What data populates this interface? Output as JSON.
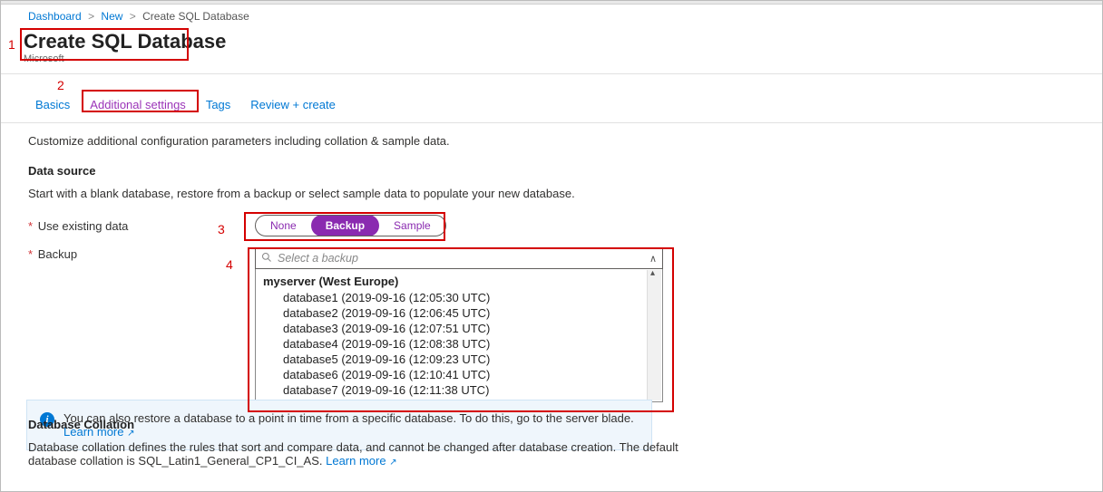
{
  "breadcrumb": {
    "items": [
      "Dashboard",
      "New",
      "Create SQL Database"
    ]
  },
  "header": {
    "title": "Create SQL Database",
    "subtitle": "Microsoft"
  },
  "tabs": [
    {
      "label": "Basics"
    },
    {
      "label": "Additional settings"
    },
    {
      "label": "Tags"
    },
    {
      "label": "Review + create"
    }
  ],
  "active_tab_index": 1,
  "description": "Customize additional configuration parameters including collation & sample data.",
  "data_source": {
    "title": "Data source",
    "text": "Start with a blank database, restore from a backup or select sample data to populate your new database.",
    "use_existing_label": "Use existing data",
    "options": [
      "None",
      "Backup",
      "Sample"
    ],
    "selected_index": 1,
    "backup_label": "Backup",
    "backup_placeholder": "Select a backup",
    "backup_group": "myserver (West Europe)",
    "backup_items": [
      "database1 (2019-09-16 (12:05:30 UTC)",
      "database2 (2019-09-16 (12:06:45 UTC)",
      "database3 (2019-09-16 (12:07:51 UTC)",
      "database4 (2019-09-16 (12:08:38 UTC)",
      "database5 (2019-09-16 (12:09:23 UTC)",
      "database6 (2019-09-16 (12:10:41 UTC)",
      "database7 (2019-09-16 (12:11:38 UTC)"
    ]
  },
  "info": {
    "text": "You can also restore a database to a point in time from a specific database. To do this, go to the server blade. ",
    "link": "Learn more"
  },
  "collation": {
    "title": "Database Collation",
    "text": "Database collation defines the rules that sort and compare data, and cannot be changed after database creation. The default database collation is SQL_Latin1_General_CP1_CI_AS. ",
    "link": "Learn more"
  },
  "annotations": {
    "n1": "1",
    "n2": "2",
    "n3": "3",
    "n4": "4"
  }
}
